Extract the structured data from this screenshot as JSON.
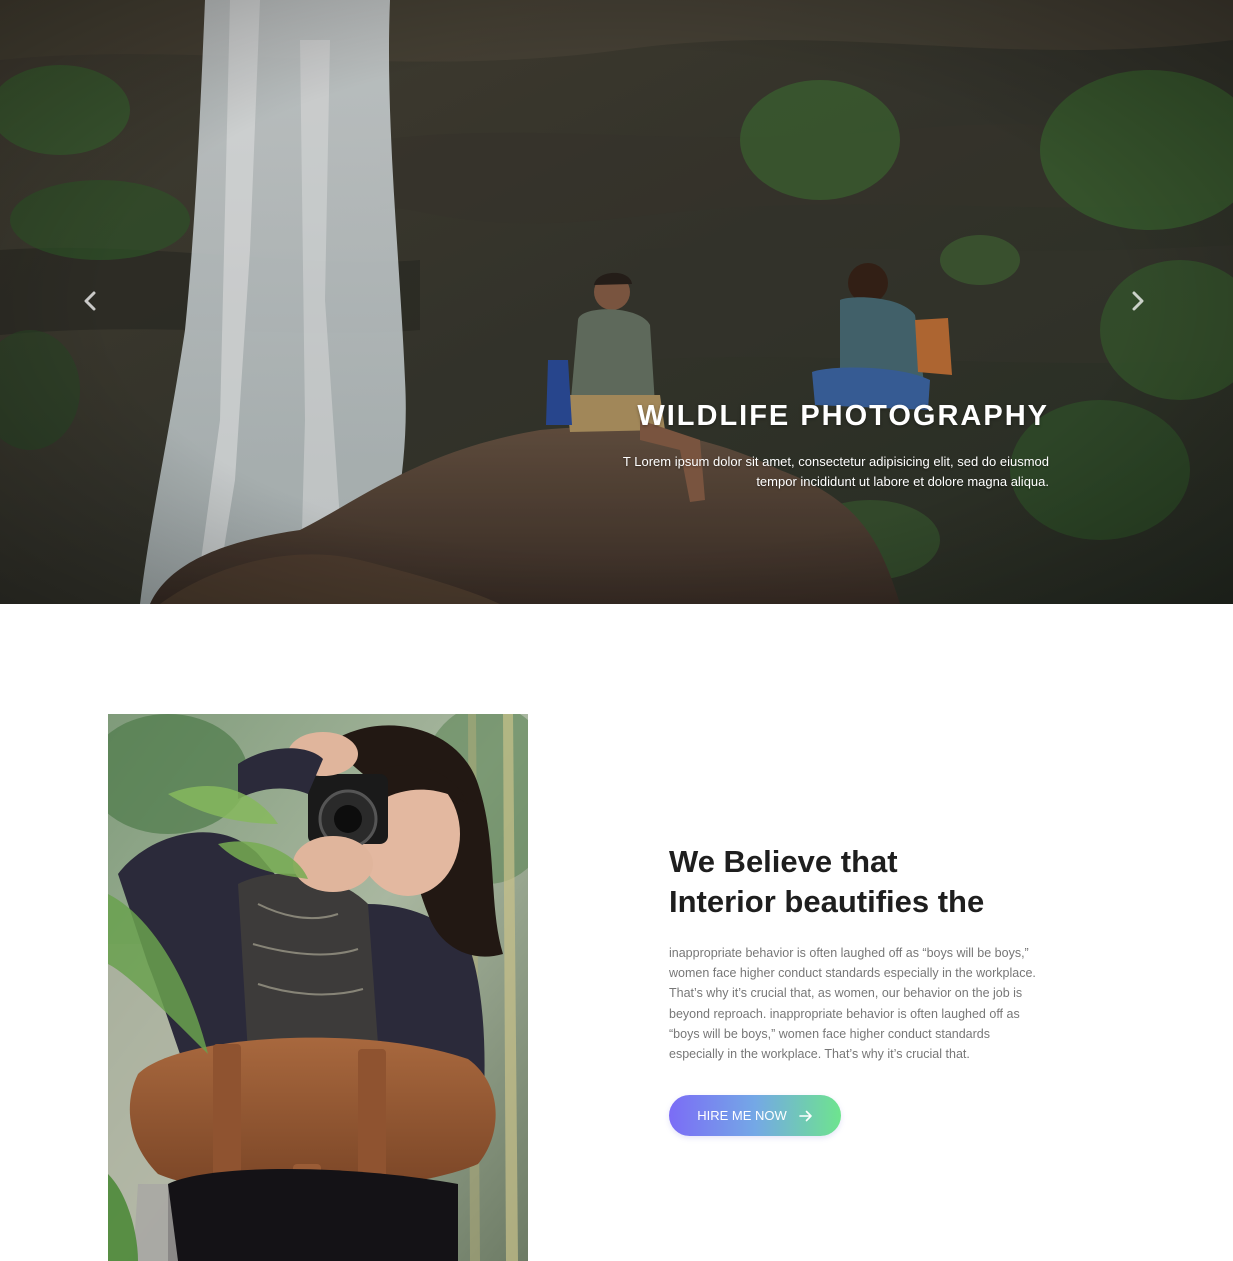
{
  "hero": {
    "title": "WILDLIFE PHOTOGRAPHY",
    "text_line1": "T Lorem ipsum dolor sit amet, consectetur adipisicing elit, sed do eiusmod",
    "text_line2": "tempor incididunt ut labore et dolore magna aliqua.",
    "prev_icon": "chevron-left-icon",
    "next_icon": "chevron-right-icon",
    "image": "waterfall-photographers-scene"
  },
  "about": {
    "image": "woman-with-camera",
    "heading_line1": "We Believe that",
    "heading_line2": "Interior beautifies the",
    "paragraph": [
      "inappropriate behavior is often laughed off as “boys will be boys,”",
      "women face higher conduct standards especially in the workplace.",
      "That’s why it’s crucial that, as women, our behavior on the job is",
      "beyond reproach. inappropriate behavior is often laughed off as",
      "“boys will be boys,” women face higher conduct standards",
      "especially in the workplace. That’s why it’s crucial that."
    ],
    "button_label": "HIRE ME NOW",
    "button_icon": "arrow-right-icon"
  },
  "colors": {
    "heading": "#1e1e1e",
    "body_text": "#777777",
    "button_gradient_start": "#7b6cf6",
    "button_gradient_end": "#6ee48e"
  }
}
